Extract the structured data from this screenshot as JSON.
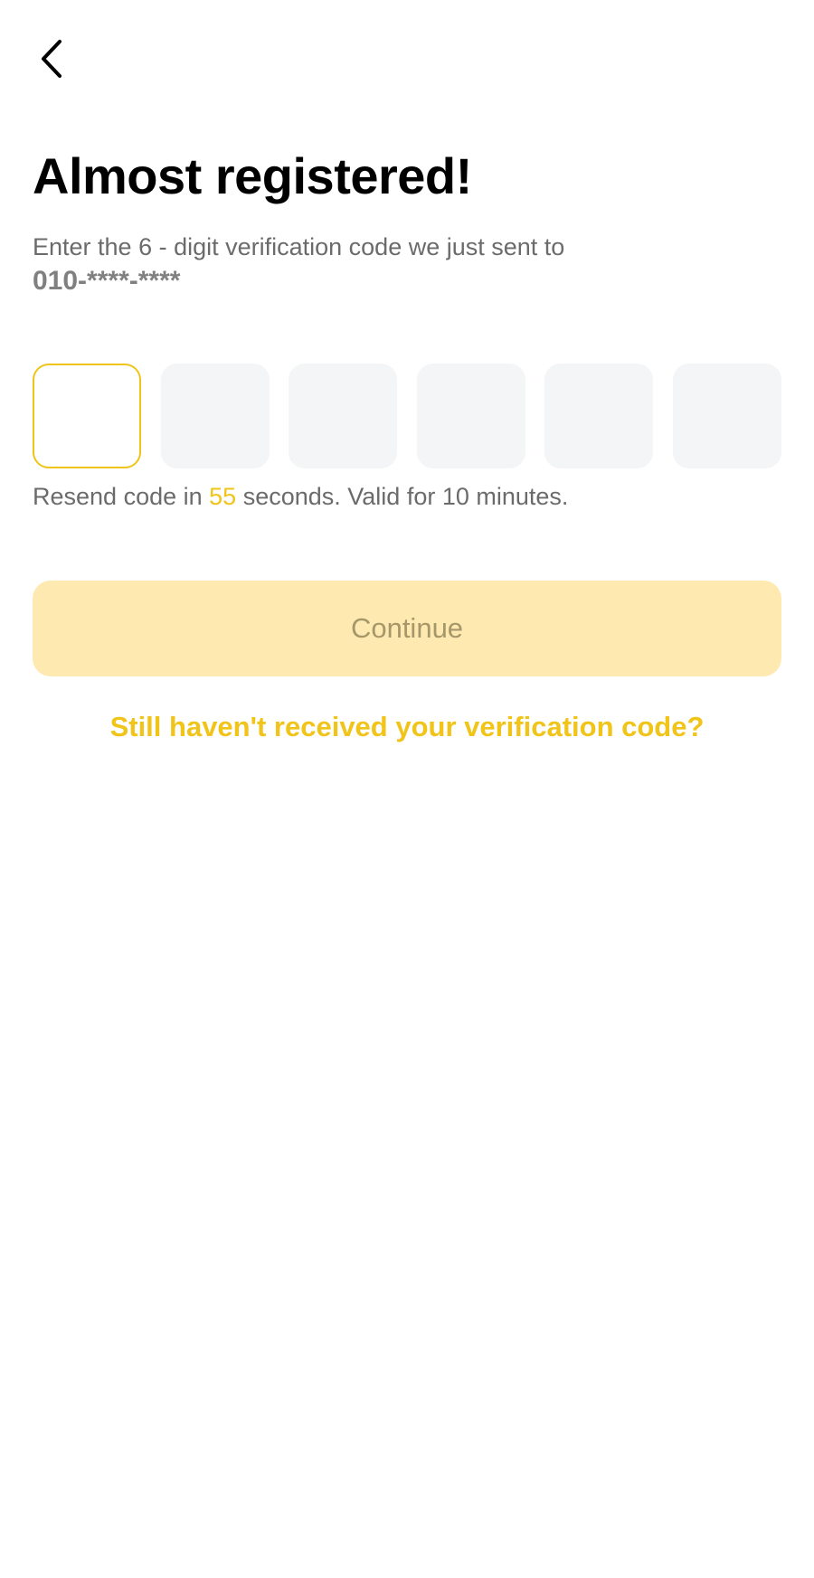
{
  "header": {
    "back_icon": "chevron-left-icon"
  },
  "title": "Almost registered!",
  "subtitle": {
    "text": "Enter the 6 - digit verification code we just sent to",
    "phone": "010-****-****"
  },
  "code_input": {
    "digits": [
      "",
      "",
      "",
      "",
      "",
      ""
    ],
    "active_index": 0
  },
  "resend": {
    "prefix": "Resend code in",
    "seconds": "55",
    "suffix": "seconds. Valid for 10 minutes."
  },
  "continue_button": {
    "label": "Continue"
  },
  "help_link": {
    "label": "Still haven't received your verification code?"
  },
  "colors": {
    "accent": "#f0c419",
    "button_disabled_bg": "#feeab0",
    "button_disabled_text": "#a6976b",
    "input_bg": "#f4f5f6",
    "secondary_text": "#6b6b6b"
  }
}
